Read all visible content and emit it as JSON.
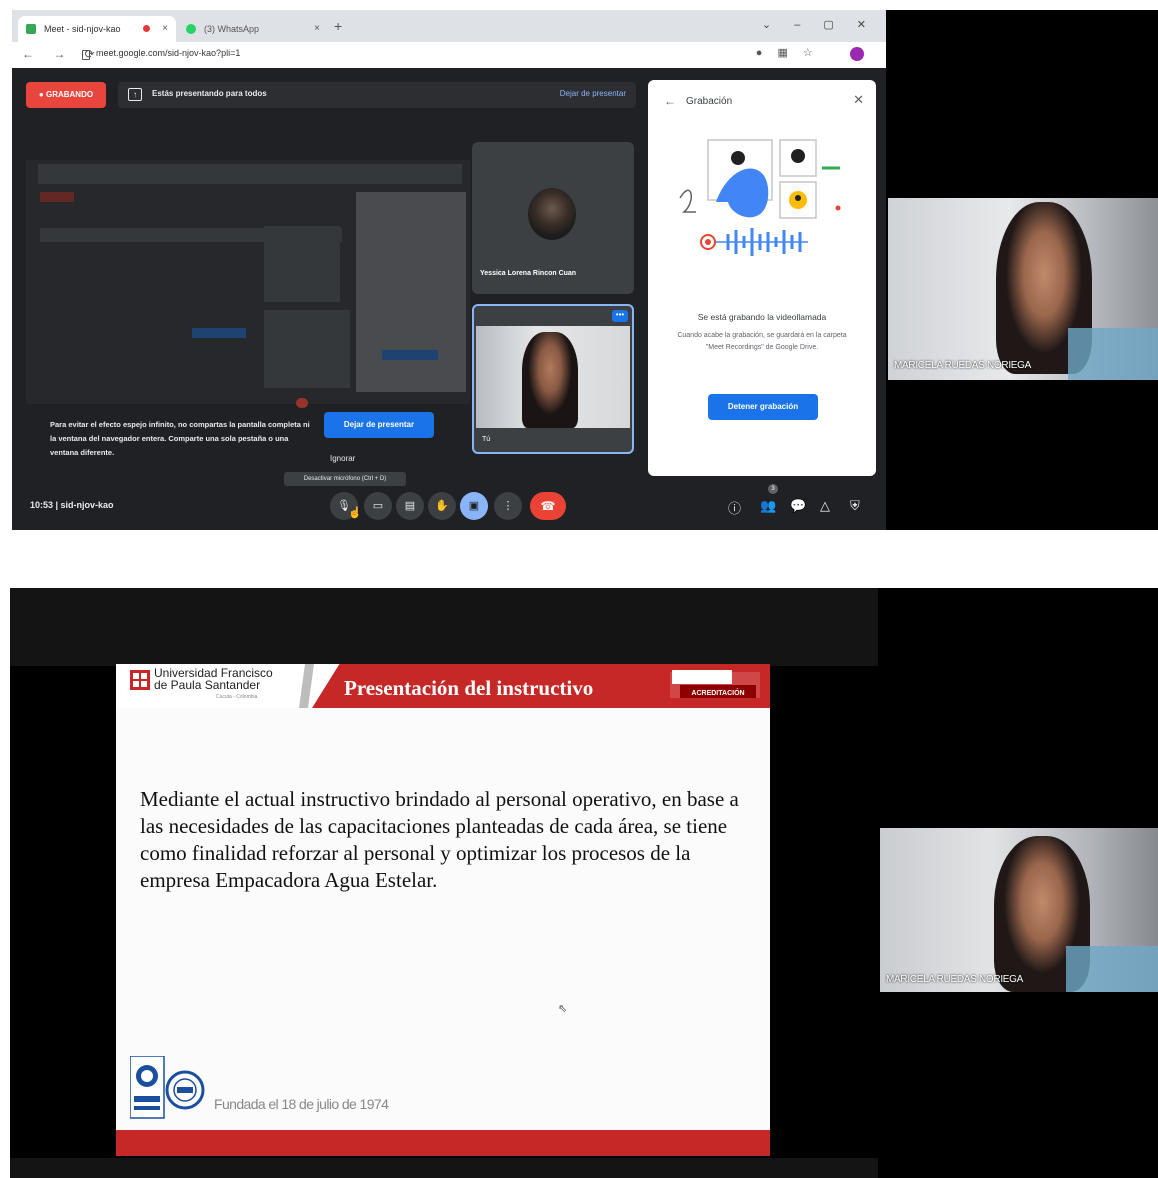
{
  "meet": {
    "tabs": [
      {
        "label": "Meet - sid-njov-kao",
        "close": "×"
      },
      {
        "label": "(3) WhatsApp",
        "close": "×"
      }
    ],
    "new_tab": "+",
    "window_controls": "⌄ – ▢ ✕",
    "url": "meet.google.com/sid-njov-kao?pli=1",
    "recording_badge": "GRABANDO",
    "presenting_text": "Estás presentando para todos",
    "stop_presenting_link": "Dejar de presentar",
    "mirror_tip": "Para evitar el efecto espejo infinito, no compartas la pantalla completa ni la ventana del navegador entera. Comparte una sola pestaña o una ventana diferente.",
    "mirror_tip_button": "Dejar de presentar",
    "ignore": "Ignorar",
    "mic_tooltip": "Desactivar micrófono (Ctrl + D)",
    "participant_1": "Yessica Lorena Rincon Cuan",
    "self_label": "Tú",
    "recording_panel": {
      "title": "Grabación",
      "heading": "Se está grabando la videollamada",
      "description": "Cuando acabe la grabación, se guardará en la carpeta \"Meet Recordings\" de Google Drive.",
      "stop_button": "Detener grabación"
    },
    "meeting_info": "10:53  |  sid-njov-kao",
    "participant_count": "3",
    "camera_name": "MARICELA RUEDAS NORIEGA"
  },
  "slide": {
    "university_line1": "Universidad Francisco",
    "university_line2": "de Paula Santander",
    "university_sub": "Cúcuta - Colombia",
    "title": "Presentación del instructivo",
    "accreditation": "ACREDITACIÓN",
    "body": "Mediante el actual instructivo brindado al personal operativo, en base a las necesidades de las capacitaciones planteadas de cada área, se tiene como finalidad reforzar al personal y optimizar los procesos de la empresa Empacadora Agua Estelar.",
    "founded": "Fundada el 18 de julio de 1974",
    "camera_name": "MARICELA RUEDAS NORIEGA"
  },
  "colors": {
    "meet_bg": "#202124",
    "accent_blue": "#1a73e8",
    "record_red": "#e8453c",
    "ufps_red": "#c62828"
  }
}
